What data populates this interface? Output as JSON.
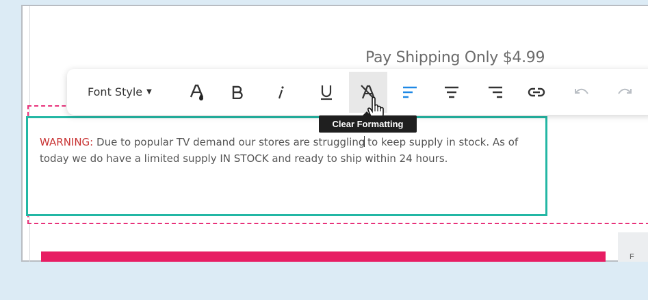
{
  "page": {
    "headline": "Pay Shipping Only $4.99"
  },
  "toolbar": {
    "font_style_label": "Font Style",
    "buttons": [
      {
        "name": "font-color-button",
        "icon": "font-color-icon"
      },
      {
        "name": "bold-button",
        "icon": "bold-icon"
      },
      {
        "name": "italic-button",
        "icon": "italic-icon"
      },
      {
        "name": "underline-button",
        "icon": "underline-icon"
      },
      {
        "name": "clear-formatting-button",
        "icon": "clear-formatting-icon"
      },
      {
        "name": "align-left-button",
        "icon": "align-left-icon"
      },
      {
        "name": "align-center-button",
        "icon": "align-center-icon"
      },
      {
        "name": "align-right-button",
        "icon": "align-right-icon"
      },
      {
        "name": "link-button",
        "icon": "link-icon"
      },
      {
        "name": "undo-button",
        "icon": "undo-icon"
      },
      {
        "name": "redo-button",
        "icon": "redo-icon"
      }
    ],
    "active_color": "#1e88e5",
    "icon_color": "#333333"
  },
  "tooltip": {
    "text": "Clear Formatting"
  },
  "warning": {
    "label": "WARNING:",
    "text_part1": " Due to popular TV demand our stores are struggling",
    "text_part2": " to keep supply in stock. As of today we do have a limited supply IN STOCK and ready to ship within 24 hours.",
    "label_color": "#c83232"
  },
  "side_panel": {
    "text": "F"
  },
  "colors": {
    "background": "#dcebf5",
    "teal_border": "#23b7a4",
    "pink_dashed": "#e8317a",
    "pink_bar": "#e71d63"
  }
}
